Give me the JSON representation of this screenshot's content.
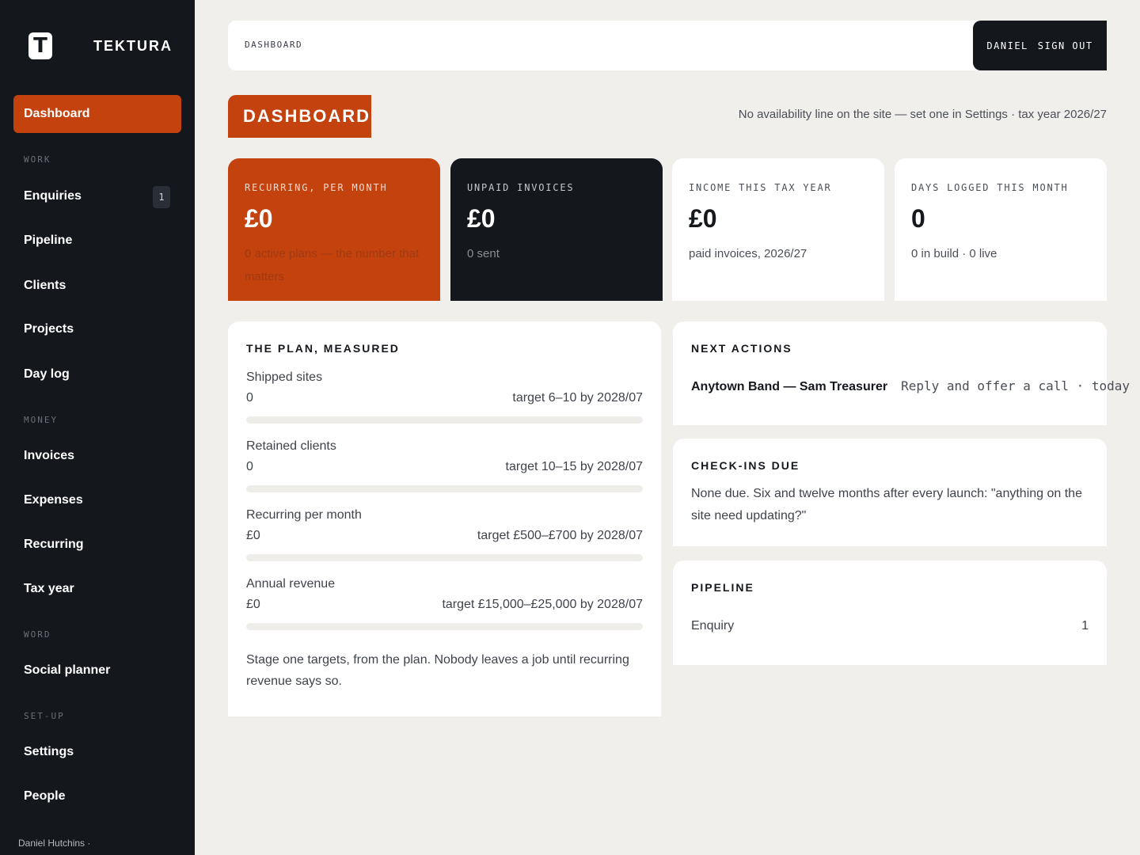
{
  "brand": {
    "logo_letter": "T",
    "name": "TEKTURA"
  },
  "sidebar": {
    "active": {
      "label": "Dashboard"
    },
    "sections": [
      {
        "title": "WORK",
        "items": [
          {
            "label": "Enquiries",
            "badge": "1"
          },
          {
            "label": "Pipeline"
          },
          {
            "label": "Clients"
          },
          {
            "label": "Projects"
          },
          {
            "label": "Day log"
          }
        ]
      },
      {
        "title": "MONEY",
        "items": [
          {
            "label": "Invoices"
          },
          {
            "label": "Expenses"
          },
          {
            "label": "Recurring"
          },
          {
            "label": "Tax year"
          }
        ]
      },
      {
        "title": "WORD",
        "items": [
          {
            "label": "Social planner"
          }
        ]
      },
      {
        "title": "SET-UP",
        "items": [
          {
            "label": "Settings"
          },
          {
            "label": "People"
          }
        ]
      }
    ],
    "footer": "Daniel Hutchins ·"
  },
  "topbar": {
    "breadcrumb": "DASHBOARD",
    "user": "DANIEL",
    "sign_out": "SIGN OUT"
  },
  "page": {
    "title": "DASHBOARD",
    "notice": "No availability line on the site — set one in Settings · tax year 2026/27"
  },
  "stats": [
    {
      "label": "RECURRING, PER MONTH",
      "value": "£0",
      "sub": "0 active plans — the number that matters"
    },
    {
      "label": "UNPAID INVOICES",
      "value": "£0",
      "sub": "0 sent"
    },
    {
      "label": "INCOME THIS TAX YEAR",
      "value": "£0",
      "sub": "paid invoices, 2026/27"
    },
    {
      "label": "DAYS LOGGED THIS MONTH",
      "value": "0",
      "sub": "0 in build · 0 live"
    }
  ],
  "plan": {
    "heading": "THE PLAN, MEASURED",
    "metrics": [
      {
        "name": "Shipped sites",
        "current": "0",
        "target": "target 6–10 by 2028/07",
        "progress": 0
      },
      {
        "name": "Retained clients",
        "current": "0",
        "target": "target 10–15 by 2028/07",
        "progress": 0
      },
      {
        "name": "Recurring per month",
        "current": "£0",
        "target": "target £500–£700 by 2028/07",
        "progress": 0
      },
      {
        "name": "Annual revenue",
        "current": "£0",
        "target": "target £15,000–£25,000 by 2028/07",
        "progress": 0
      }
    ],
    "note": "Stage one targets, from the plan. Nobody leaves a job until recurring revenue says so."
  },
  "next_actions": {
    "heading": "NEXT ACTIONS",
    "items": [
      {
        "who": "Anytown Band — Sam Treasurer",
        "what": "Reply and offer a call · today"
      }
    ]
  },
  "checkins": {
    "heading": "CHECK-INS DUE",
    "text": "None due. Six and twelve months after every launch: \"anything on the site need updating?\""
  },
  "pipeline": {
    "heading": "PIPELINE",
    "rows": [
      {
        "stage": "Enquiry",
        "count": "1"
      }
    ]
  },
  "colors": {
    "accent": "#c4420e",
    "dark": "#14171c",
    "background": "#f1efec"
  }
}
